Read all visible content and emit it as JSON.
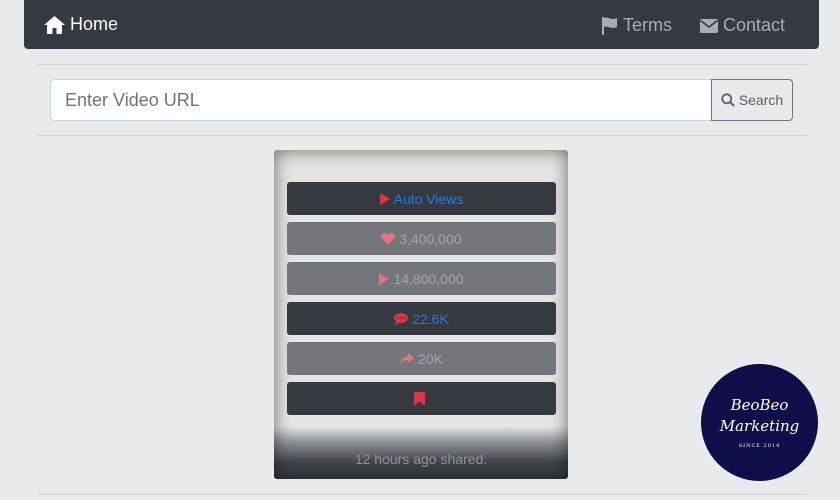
{
  "navbar": {
    "home_label": "Home",
    "terms_label": "Terms",
    "contact_label": "Contact"
  },
  "search": {
    "placeholder": "Enter Video URL",
    "button_label": "Search"
  },
  "card": {
    "auto_views_label": "Auto Views",
    "likes": "3,400,000",
    "plays": "14,800,000",
    "comments": "22.6K",
    "shares": "20K",
    "shared_time": "12 hours ago shared."
  },
  "logo": {
    "line1": "BeoBeo",
    "line2": "Marketing",
    "line3": "SINCE 2014"
  },
  "colors": {
    "navbar": "#343a40",
    "accent_red": "#dc3545",
    "accent_blue": "#1e7bf2",
    "logo_bg": "#0f0d4a"
  }
}
